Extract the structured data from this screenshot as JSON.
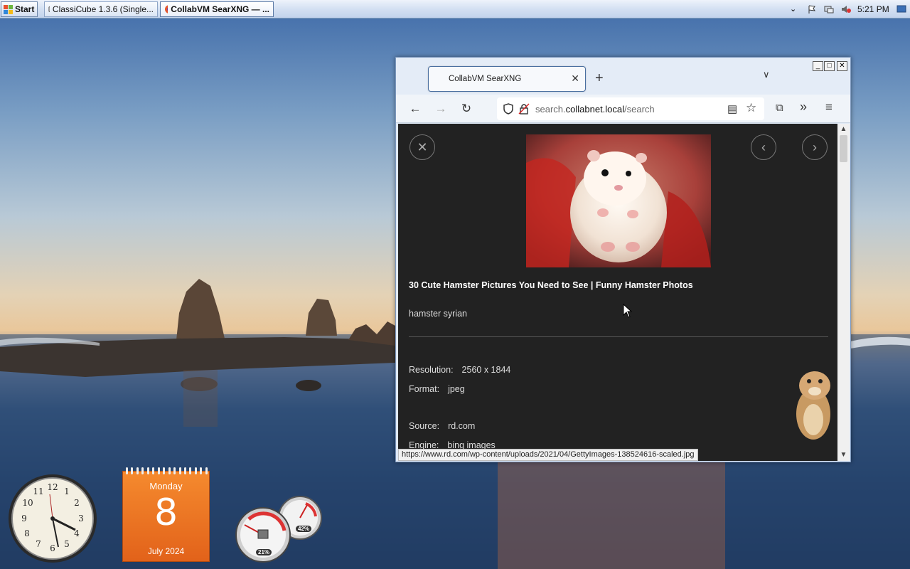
{
  "taskbar": {
    "start_label": "Start",
    "tasks": [
      {
        "label": "ClassiCube 1.3.6 (Single...",
        "active": false
      },
      {
        "label": "CollabVM SearXNG — ...",
        "active": true
      }
    ],
    "clock": "5:21 PM"
  },
  "browser": {
    "tab_title": "CollabVM SearXNG",
    "url_prefix": "search.",
    "url_host": "collabnet.local",
    "url_path": "/search",
    "status_url": "https://www.rd.com/wp-content/uploads/2021/04/GettyImages-138524616-scaled.jpg"
  },
  "result": {
    "title": "30 Cute Hamster Pictures You Need to See | Funny Hamster Photos",
    "description": "hamster syrian",
    "resolution_label": "Resolution:",
    "resolution_value": "2560 x 1844",
    "format_label": "Format:",
    "format_value": "jpeg",
    "source_label": "Source:",
    "source_value": "rd.com",
    "engine_label": "Engine:",
    "engine_value": "bing images"
  },
  "calendar": {
    "day_name": "Monday",
    "day_number": "8",
    "month_year": "July 2024"
  },
  "meters": {
    "cpu": "21%",
    "memory": "42%"
  },
  "colors": {
    "page_bg": "#222222",
    "calendar_orange": "#f07a26",
    "taskbar": "#d6e2f3"
  }
}
